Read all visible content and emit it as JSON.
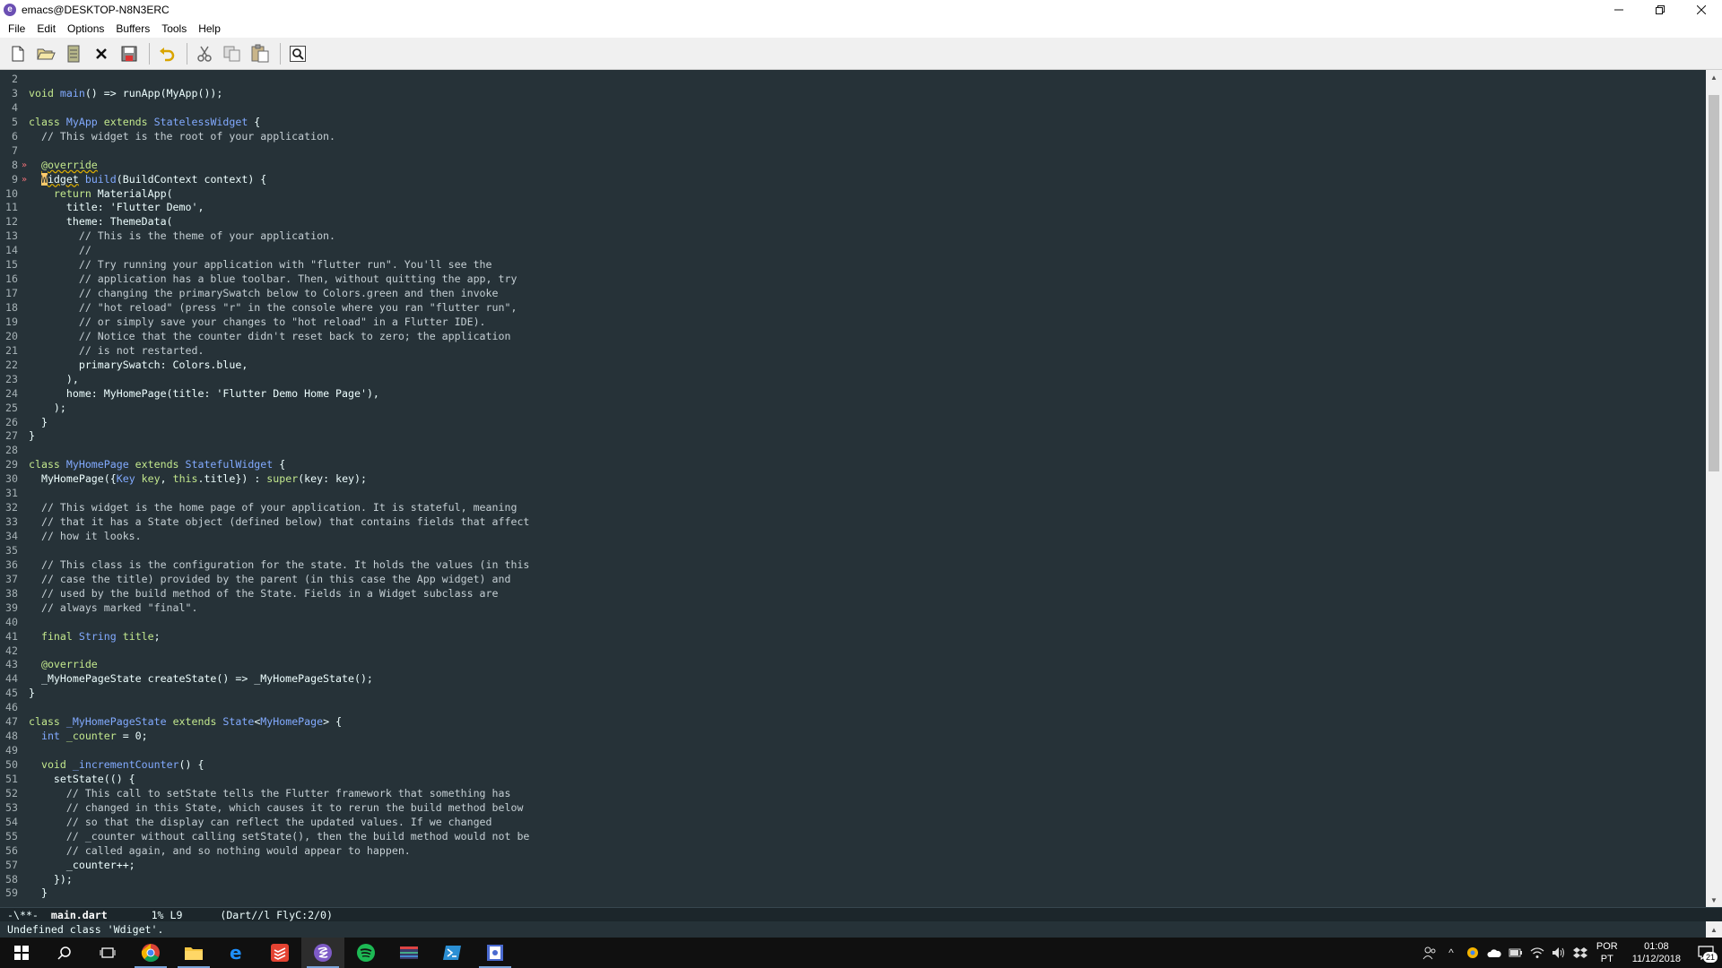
{
  "window": {
    "title": "emacs@DESKTOP-N8N3ERC",
    "app_icon_letter": "e"
  },
  "menu": [
    "File",
    "Edit",
    "Options",
    "Buffers",
    "Tools",
    "Help"
  ],
  "toolbar": {
    "icons": [
      "new-file-icon",
      "open-folder-icon",
      "open-directory-icon",
      "close-buffer-icon",
      "save-icon",
      "undo-icon",
      "cut-icon",
      "copy-icon",
      "paste-icon",
      "search-icon"
    ]
  },
  "editor": {
    "lines": [
      {
        "n": "2",
        "mark": "",
        "segs": []
      },
      {
        "n": "3",
        "mark": "",
        "segs": [
          [
            "kw",
            "void "
          ],
          [
            "fn",
            "main"
          ],
          [
            "",
            "() => runApp(MyApp());"
          ]
        ]
      },
      {
        "n": "4",
        "mark": "",
        "segs": []
      },
      {
        "n": "5",
        "mark": "",
        "segs": [
          [
            "kw",
            "class "
          ],
          [
            "ty",
            "MyApp "
          ],
          [
            "kw",
            "extends "
          ],
          [
            "ty",
            "StatelessWidget"
          ],
          [
            "",
            " {"
          ]
        ]
      },
      {
        "n": "6",
        "mark": "",
        "segs": [
          [
            "cm",
            "  // This widget is the root of your application."
          ]
        ]
      },
      {
        "n": "7",
        "mark": "",
        "segs": []
      },
      {
        "n": "8",
        "mark": "»",
        "segs": [
          [
            "",
            "  "
          ],
          [
            "an warn-underline",
            "@override"
          ]
        ]
      },
      {
        "n": "9",
        "mark": "»",
        "segs": [
          [
            "",
            "  "
          ],
          [
            "cursor",
            "W"
          ],
          [
            "warn-underline",
            "idget"
          ],
          [
            "",
            " "
          ],
          [
            "fn",
            "build"
          ],
          [
            "",
            "(BuildContext context) {"
          ]
        ]
      },
      {
        "n": "10",
        "mark": "",
        "segs": [
          [
            "",
            "    "
          ],
          [
            "kw",
            "return "
          ],
          [
            "",
            "MaterialApp("
          ]
        ]
      },
      {
        "n": "11",
        "mark": "",
        "segs": [
          [
            "",
            "      title: "
          ],
          [
            "st",
            "'Flutter Demo'"
          ],
          [
            "",
            ","
          ]
        ]
      },
      {
        "n": "12",
        "mark": "",
        "segs": [
          [
            "",
            "      theme: ThemeData("
          ]
        ]
      },
      {
        "n": "13",
        "mark": "",
        "segs": [
          [
            "cm",
            "        // This is the theme of your application."
          ]
        ]
      },
      {
        "n": "14",
        "mark": "",
        "segs": [
          [
            "cm",
            "        //"
          ]
        ]
      },
      {
        "n": "15",
        "mark": "",
        "segs": [
          [
            "cm",
            "        // Try running your application with \"flutter run\". You'll see the"
          ]
        ]
      },
      {
        "n": "16",
        "mark": "",
        "segs": [
          [
            "cm",
            "        // application has a blue toolbar. Then, without quitting the app, try"
          ]
        ]
      },
      {
        "n": "17",
        "mark": "",
        "segs": [
          [
            "cm",
            "        // changing the primarySwatch below to Colors.green and then invoke"
          ]
        ]
      },
      {
        "n": "18",
        "mark": "",
        "segs": [
          [
            "cm",
            "        // \"hot reload\" (press \"r\" in the console where you ran \"flutter run\","
          ]
        ]
      },
      {
        "n": "19",
        "mark": "",
        "segs": [
          [
            "cm",
            "        // or simply save your changes to \"hot reload\" in a Flutter IDE)."
          ]
        ]
      },
      {
        "n": "20",
        "mark": "",
        "segs": [
          [
            "cm",
            "        // Notice that the counter didn't reset back to zero; the application"
          ]
        ]
      },
      {
        "n": "21",
        "mark": "",
        "segs": [
          [
            "cm",
            "        // is not restarted."
          ]
        ]
      },
      {
        "n": "22",
        "mark": "",
        "segs": [
          [
            "",
            "        primarySwatch: Colors.blue,"
          ]
        ]
      },
      {
        "n": "23",
        "mark": "",
        "segs": [
          [
            "",
            "      ),"
          ]
        ]
      },
      {
        "n": "24",
        "mark": "",
        "segs": [
          [
            "",
            "      home: MyHomePage(title: "
          ],
          [
            "st",
            "'Flutter Demo Home Page'"
          ],
          [
            "",
            "),"
          ]
        ]
      },
      {
        "n": "25",
        "mark": "",
        "segs": [
          [
            "",
            "    );"
          ]
        ]
      },
      {
        "n": "26",
        "mark": "",
        "segs": [
          [
            "",
            "  }"
          ]
        ]
      },
      {
        "n": "27",
        "mark": "",
        "segs": [
          [
            "",
            "}"
          ]
        ]
      },
      {
        "n": "28",
        "mark": "",
        "segs": []
      },
      {
        "n": "29",
        "mark": "",
        "segs": [
          [
            "kw",
            "class "
          ],
          [
            "ty",
            "MyHomePage "
          ],
          [
            "kw",
            "extends "
          ],
          [
            "ty",
            "StatefulWidget"
          ],
          [
            "",
            " {"
          ]
        ]
      },
      {
        "n": "30",
        "mark": "",
        "segs": [
          [
            "",
            "  MyHomePage({"
          ],
          [
            "ty",
            "Key"
          ],
          [
            "",
            " "
          ],
          [
            "kw",
            "key"
          ],
          [
            "",
            ", "
          ],
          [
            "kw",
            "this"
          ],
          [
            "",
            ".title}) : "
          ],
          [
            "kw",
            "super"
          ],
          [
            "",
            "(key: key);"
          ]
        ]
      },
      {
        "n": "31",
        "mark": "",
        "segs": []
      },
      {
        "n": "32",
        "mark": "",
        "segs": [
          [
            "cm",
            "  // This widget is the home page of your application. It is stateful, meaning"
          ]
        ]
      },
      {
        "n": "33",
        "mark": "",
        "segs": [
          [
            "cm",
            "  // that it has a State object (defined below) that contains fields that affect"
          ]
        ]
      },
      {
        "n": "34",
        "mark": "",
        "segs": [
          [
            "cm",
            "  // how it looks."
          ]
        ]
      },
      {
        "n": "35",
        "mark": "",
        "segs": []
      },
      {
        "n": "36",
        "mark": "",
        "segs": [
          [
            "cm",
            "  // This class is the configuration for the state. It holds the values (in this"
          ]
        ]
      },
      {
        "n": "37",
        "mark": "",
        "segs": [
          [
            "cm",
            "  // case the title) provided by the parent (in this case the App widget) and"
          ]
        ]
      },
      {
        "n": "38",
        "mark": "",
        "segs": [
          [
            "cm",
            "  // used by the build method of the State. Fields in a Widget subclass are"
          ]
        ]
      },
      {
        "n": "39",
        "mark": "",
        "segs": [
          [
            "cm",
            "  // always marked \"final\"."
          ]
        ]
      },
      {
        "n": "40",
        "mark": "",
        "segs": []
      },
      {
        "n": "41",
        "mark": "",
        "segs": [
          [
            "",
            "  "
          ],
          [
            "kw",
            "final "
          ],
          [
            "ty",
            "String "
          ],
          [
            "kw",
            "title"
          ],
          [
            "",
            ";"
          ]
        ]
      },
      {
        "n": "42",
        "mark": "",
        "segs": []
      },
      {
        "n": "43",
        "mark": "",
        "segs": [
          [
            "",
            "  "
          ],
          [
            "an",
            "@override"
          ]
        ]
      },
      {
        "n": "44",
        "mark": "",
        "segs": [
          [
            "",
            "  _MyHomePageState createState() => _MyHomePageState();"
          ]
        ]
      },
      {
        "n": "45",
        "mark": "",
        "segs": [
          [
            "",
            "}"
          ]
        ]
      },
      {
        "n": "46",
        "mark": "",
        "segs": []
      },
      {
        "n": "47",
        "mark": "",
        "segs": [
          [
            "kw",
            "class "
          ],
          [
            "ty",
            "_MyHomePageState "
          ],
          [
            "kw",
            "extends "
          ],
          [
            "ty",
            "State"
          ],
          [
            "",
            "<"
          ],
          [
            "ty",
            "MyHomePage"
          ],
          [
            "",
            "> {"
          ]
        ]
      },
      {
        "n": "48",
        "mark": "",
        "segs": [
          [
            "",
            "  "
          ],
          [
            "ty",
            "int "
          ],
          [
            "kw",
            "_counter"
          ],
          [
            "",
            " = 0;"
          ]
        ]
      },
      {
        "n": "49",
        "mark": "",
        "segs": []
      },
      {
        "n": "50",
        "mark": "",
        "segs": [
          [
            "",
            "  "
          ],
          [
            "kw",
            "void "
          ],
          [
            "fn",
            "_incrementCounter"
          ],
          [
            "",
            "() {"
          ]
        ]
      },
      {
        "n": "51",
        "mark": "",
        "segs": [
          [
            "",
            "    setState(() {"
          ]
        ]
      },
      {
        "n": "52",
        "mark": "",
        "segs": [
          [
            "cm",
            "      // This call to setState tells the Flutter framework that something has"
          ]
        ]
      },
      {
        "n": "53",
        "mark": "",
        "segs": [
          [
            "cm",
            "      // changed in this State, which causes it to rerun the build method below"
          ]
        ]
      },
      {
        "n": "54",
        "mark": "",
        "segs": [
          [
            "cm",
            "      // so that the display can reflect the updated values. If we changed"
          ]
        ]
      },
      {
        "n": "55",
        "mark": "",
        "segs": [
          [
            "cm",
            "      // _counter without calling setState(), then the build method would not be"
          ]
        ]
      },
      {
        "n": "56",
        "mark": "",
        "segs": [
          [
            "cm",
            "      // called again, and so nothing would appear to happen."
          ]
        ]
      },
      {
        "n": "57",
        "mark": "",
        "segs": [
          [
            "",
            "      _counter++;"
          ]
        ]
      },
      {
        "n": "58",
        "mark": "",
        "segs": [
          [
            "",
            "    });"
          ]
        ]
      },
      {
        "n": "59",
        "mark": "",
        "segs": [
          [
            "",
            "  }"
          ]
        ]
      }
    ]
  },
  "modeline": {
    "status": "-\\**-  ",
    "buffer": "main.dart",
    "position": "       1% L9      ",
    "mode": "(Dart//l FlyC:2/0)"
  },
  "echo": {
    "message": "Undefined class 'Wdiget'."
  },
  "taskbar": {
    "apps": [
      "start-icon",
      "search-icon",
      "task-view-icon",
      "chrome-icon",
      "file-explorer-icon",
      "edge-icon",
      "todoist-icon",
      "emacs-icon",
      "spotify-icon",
      "app-icon",
      "powershell-icon",
      "ubuntu-icon"
    ],
    "language": {
      "line1": "POR",
      "line2": "PT"
    },
    "clock": {
      "time": "01:08",
      "date": "11/12/2018"
    },
    "notifications": "21"
  }
}
